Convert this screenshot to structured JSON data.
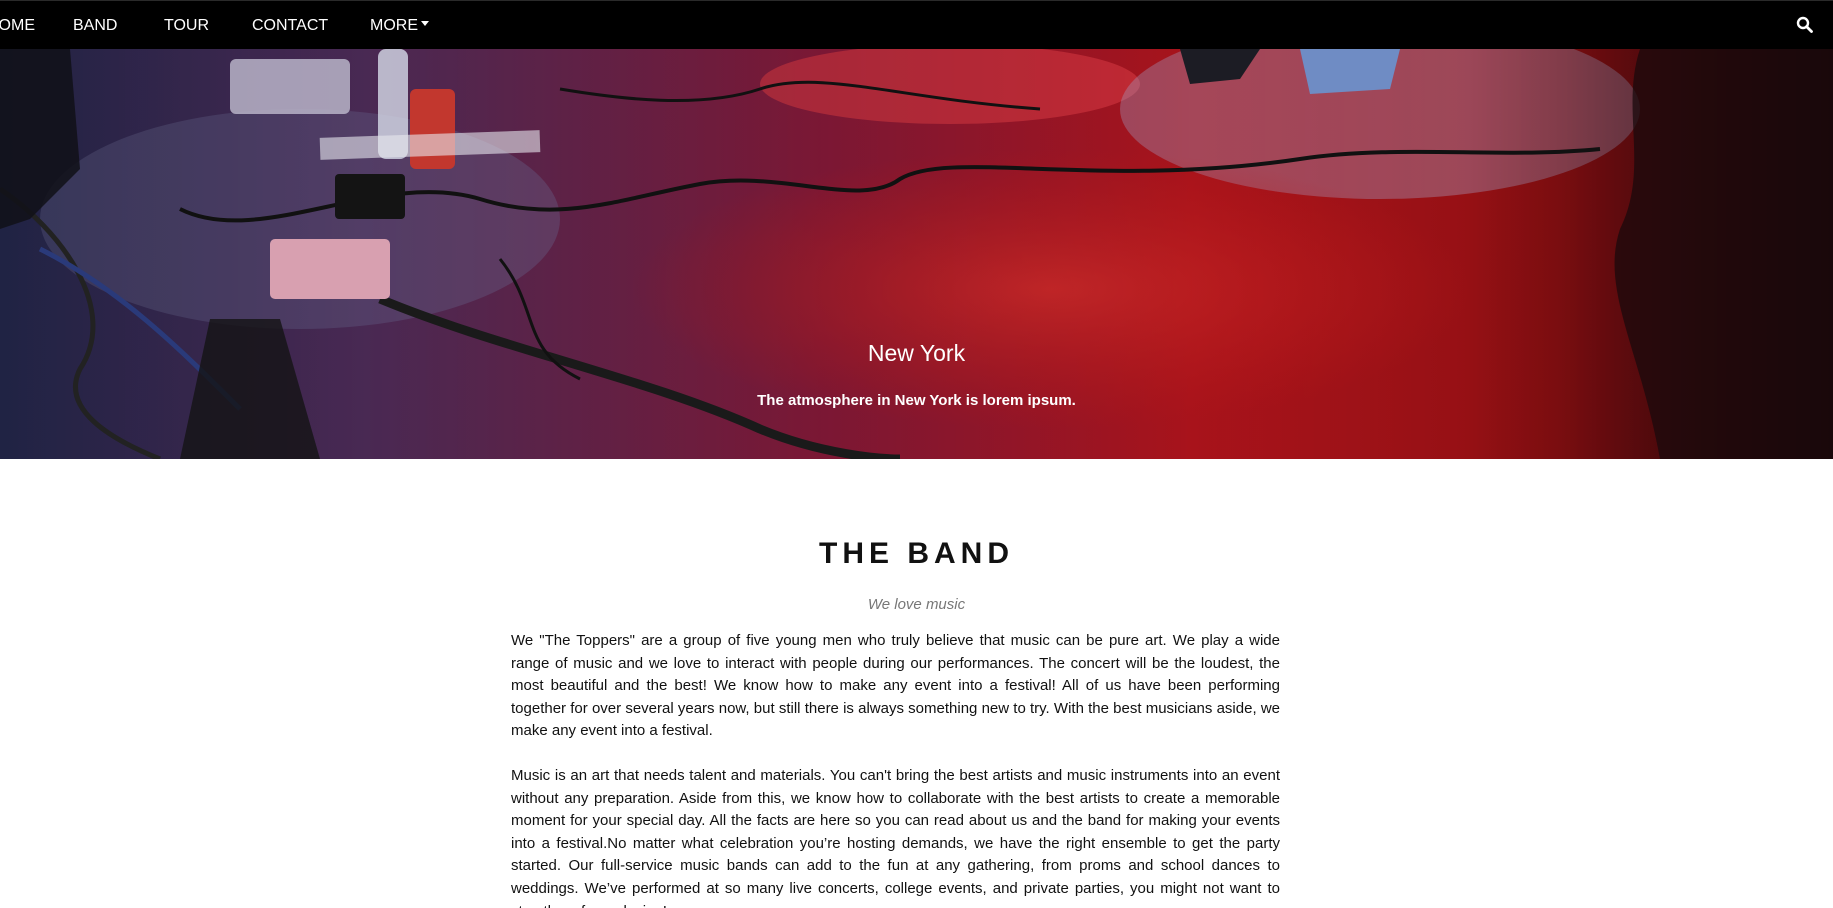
{
  "nav": {
    "items": [
      {
        "label": "HOME"
      },
      {
        "label": "BAND"
      },
      {
        "label": "TOUR"
      },
      {
        "label": "CONTACT"
      }
    ],
    "more_label": "MORE",
    "search_icon": "search-icon"
  },
  "hero": {
    "title": "New York",
    "subtitle": "The atmosphere in New York is lorem ipsum."
  },
  "band": {
    "title": "THE BAND",
    "tagline": "We love music",
    "paragraphs": [
      "We \"The Toppers\" are a group of five young men who truly believe that music can be pure art. We play a wide range of music and we love to interact with people during our performances. The concert will be the loudest, the most beautiful and the best! We know how to make any event into a festival! All of us have been performing together for over several years now, but still there is always something new to try. With the best musicians aside, we make any event into a festival.",
      "Music is an art that needs talent and materials. You can't bring the best artists and music instruments into an event without any preparation. Aside from this, we know how to collaborate with the best artists to create a memorable moment for your special day. All the facts are here so you can read about us and the band for making your events into a festival.No matter what celebration you’re hosting demands, we have the right ensemble to get the party started. Our full-service music bands can add to the fun at any gathering, from proms and school dances to weddings. We’ve performed at so many live concerts, college events, and private parties, you might not want to stop them from playing!"
    ]
  }
}
